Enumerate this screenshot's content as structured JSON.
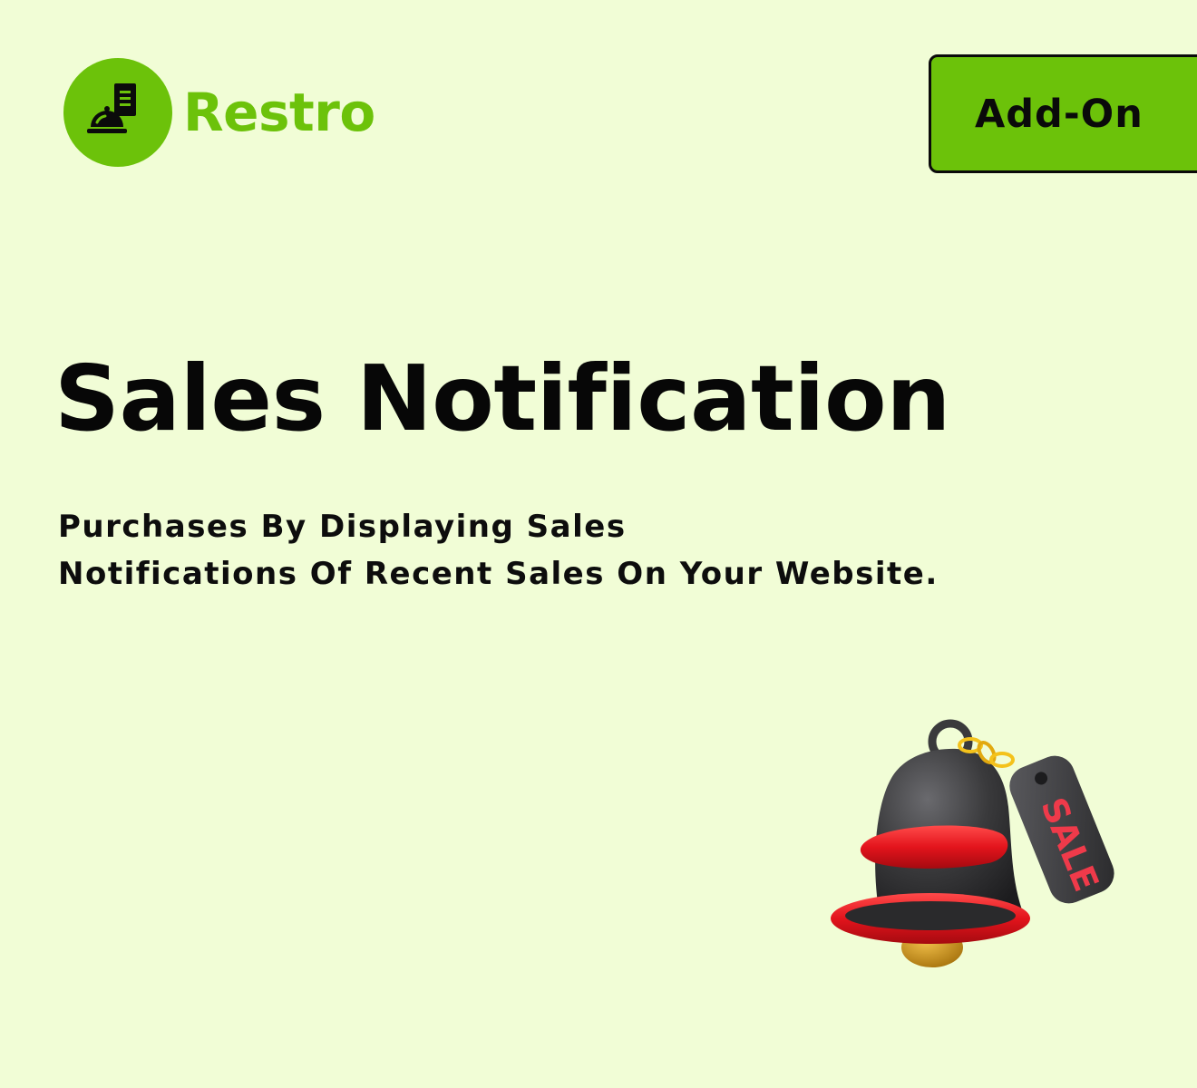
{
  "brand": {
    "name": "Restro",
    "logo_icon": "service-bell-icon",
    "accent_color": "#6cc20a"
  },
  "header": {
    "addon_label": "Add-On"
  },
  "main": {
    "title": "Sales Notification",
    "description_lines": [
      "Purchases By Displaying Sales",
      "Notifications Of Recent Sales On Your Website."
    ]
  },
  "illustration": {
    "icon": "notification-bell-icon",
    "tag_text": "SALE",
    "colors": {
      "bell": "#3a3a3c",
      "bands": "#e3141c",
      "tag_text": "#ef3a4a",
      "chain": "#f4c21b",
      "background": "#f1fdd6"
    }
  }
}
